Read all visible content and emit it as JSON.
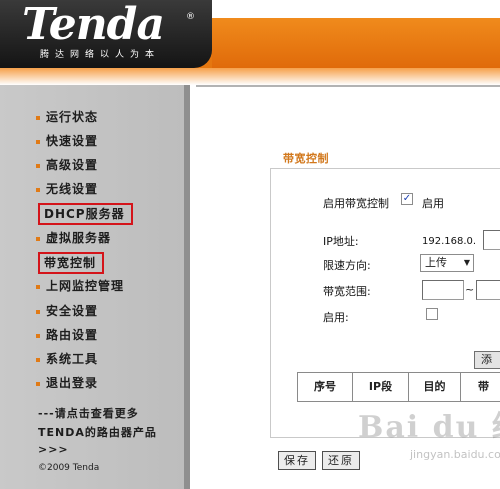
{
  "header": {
    "logo_text": "Tenda",
    "logo_reg": "®",
    "tagline": "腾达网络以人为本"
  },
  "sidebar": {
    "items": [
      {
        "label": "运行状态"
      },
      {
        "label": "快速设置"
      },
      {
        "label": "高级设置"
      },
      {
        "label": "无线设置"
      },
      {
        "label": "DHCP服务器"
      },
      {
        "label": "虚拟服务器"
      },
      {
        "label": "带宽控制"
      },
      {
        "label": "上网监控管理"
      },
      {
        "label": "安全设置"
      },
      {
        "label": "路由设置"
      },
      {
        "label": "系统工具"
      },
      {
        "label": "退出登录"
      }
    ],
    "promo_line1": "---请点击查看更多",
    "promo_line2": "TENDA的路由器产品",
    "promo_line3": ">>>",
    "copyright": "©2009 Tenda"
  },
  "panel": {
    "title": "带宽控制",
    "enable_bw_label": "启用带宽控制",
    "enable_bw_checked_mark": "✓",
    "enable_bw_option": "启用",
    "ip_label": "IP地址:",
    "ip_prefix": "192.168.0.",
    "direction_label": "限速方向:",
    "direction_value": "上传",
    "range_label": "带宽范围:",
    "range_sep": "~",
    "enable_label": "启用:",
    "add_button": "添",
    "table_headers": [
      "序号",
      "IP段",
      "目的",
      "带"
    ]
  },
  "footer": {
    "save_button": "保存",
    "restore_button": "还原"
  },
  "watermark": {
    "text": "Bai du 经验",
    "sub": "jingyan.baidu.com"
  }
}
